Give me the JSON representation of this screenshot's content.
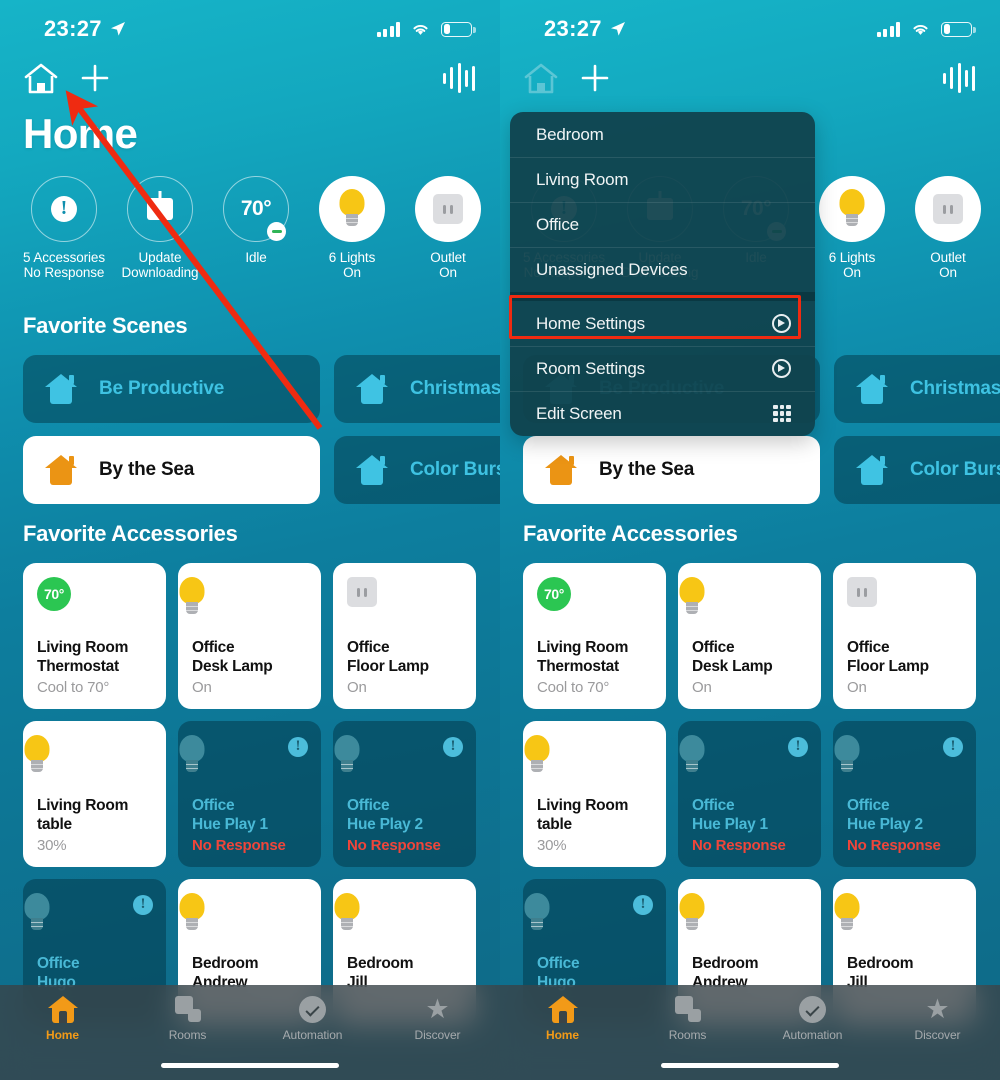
{
  "status_bar": {
    "time": "23:27",
    "location_icon": "location-arrow-icon",
    "signal_icon": "cellular-signal-icon",
    "wifi_icon": "wifi-icon",
    "battery_icon": "battery-low-icon"
  },
  "nav": {
    "home_icon": "house-outline-icon",
    "add_icon": "plus-icon",
    "audio_icon": "audio-waveform-icon"
  },
  "page_title": "Home",
  "status_tiles": [
    {
      "icon": "exclamation-circle-icon",
      "line1": "5 Accessories",
      "line2": "No Response",
      "style": "outline"
    },
    {
      "icon": "software-update-icon",
      "line1": "Update",
      "line2": "Downloading",
      "style": "outline"
    },
    {
      "icon": "temperature-value",
      "value": "70°",
      "line1": "Idle",
      "line2": "",
      "style": "outline",
      "badge": "minus-badge"
    },
    {
      "icon": "lightbulb-on-icon",
      "line1": "6 Lights",
      "line2": "On",
      "style": "filled"
    },
    {
      "icon": "outlet-icon",
      "line1": "Outlet",
      "line2": "On",
      "style": "filled"
    }
  ],
  "sections": {
    "scenes_header": "Favorite Scenes",
    "accessories_header": "Favorite Accessories"
  },
  "scenes": [
    {
      "name": "Be Productive",
      "icon": "house-icon",
      "state": "inactive"
    },
    {
      "name": "Christmas",
      "icon": "house-icon",
      "state": "inactive"
    },
    {
      "name": "By the Sea",
      "icon": "house-icon",
      "state": "active"
    },
    {
      "name": "Color Burst",
      "icon": "house-icon",
      "state": "inactive"
    }
  ],
  "accessories": [
    {
      "name": "Living Room\nThermostat",
      "line1": "Living Room",
      "line2": "Thermostat",
      "sub": "Cool to 70°",
      "icon": "thermostat-badge",
      "badge_value": "70°",
      "state": "on"
    },
    {
      "name": "Office Desk Lamp",
      "line1": "Office",
      "line2": "Desk Lamp",
      "sub": "On",
      "icon": "lightbulb-on-icon",
      "state": "on"
    },
    {
      "name": "Office Floor Lamp",
      "line1": "Office",
      "line2": "Floor Lamp",
      "sub": "On",
      "icon": "outlet-icon",
      "state": "on"
    },
    {
      "name": "Living Room table",
      "line1": "Living Room",
      "line2": "table",
      "sub": "30%",
      "icon": "lightbulb-on-icon",
      "state": "on"
    },
    {
      "name": "Office Hue Play 1",
      "line1": "Office",
      "line2": "Hue Play 1",
      "sub": "No Response",
      "icon": "lightbulb-off-icon",
      "state": "no-response",
      "warn": "!"
    },
    {
      "name": "Office Hue Play 2",
      "line1": "Office",
      "line2": "Hue Play 2",
      "sub": "No Response",
      "icon": "lightbulb-off-icon",
      "state": "no-response",
      "warn": "!"
    },
    {
      "name": "Office Hugo",
      "line1": "Office",
      "line2": "Hugo",
      "sub": "",
      "icon": "lightbulb-off-icon",
      "state": "no-response",
      "warn": "!"
    },
    {
      "name": "Bedroom Andrew",
      "line1": "Bedroom",
      "line2": "Andrew",
      "sub": "",
      "icon": "lightbulb-on-icon",
      "state": "on"
    },
    {
      "name": "Bedroom Jill",
      "line1": "Bedroom",
      "line2": "Jill",
      "sub": "",
      "icon": "lightbulb-on-icon",
      "state": "on"
    }
  ],
  "tab_bar": [
    {
      "label": "Home",
      "icon": "home-icon",
      "active": true
    },
    {
      "label": "Rooms",
      "icon": "rooms-icon",
      "active": false
    },
    {
      "label": "Automation",
      "icon": "automation-clock-icon",
      "active": false
    },
    {
      "label": "Discover",
      "icon": "star-icon",
      "active": false
    }
  ],
  "dropdown_menu": {
    "rooms": [
      {
        "label": "Bedroom",
        "icon": ""
      },
      {
        "label": "Living Room",
        "icon": ""
      },
      {
        "label": "Office",
        "icon": ""
      },
      {
        "label": "Unassigned Devices",
        "icon": ""
      }
    ],
    "actions": [
      {
        "label": "Home Settings",
        "icon": "gear-icon",
        "highlighted": true
      },
      {
        "label": "Room Settings",
        "icon": "gear-icon",
        "highlighted": false
      },
      {
        "label": "Edit Screen",
        "icon": "grid-icon",
        "highlighted": false
      }
    ]
  },
  "annotations": {
    "arrow_color": "#ef2b11",
    "highlight_color": "#ef2b11",
    "arrow_target": "house-outline-icon",
    "highlight_target": "Home Settings"
  },
  "colors": {
    "background_top": "#16b4c8",
    "background_bottom": "#0f6a87",
    "accent_orange": "#eb9414",
    "accent_blue": "#3fc3e3",
    "error_red": "#f0453a",
    "ok_green": "#2bc652",
    "bulb_yellow": "#f7c615"
  }
}
